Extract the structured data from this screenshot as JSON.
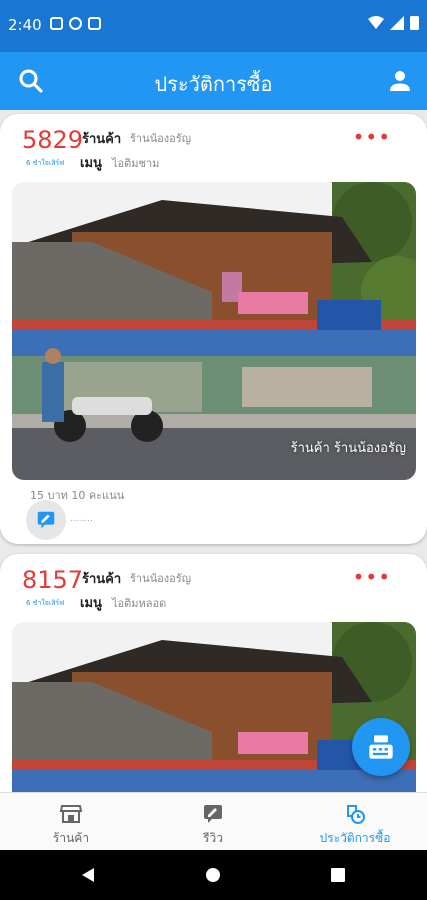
{
  "status_bar": {
    "time": "2:40"
  },
  "app_bar": {
    "title": "ประวัติการซื้อ",
    "search_icon": "search-icon",
    "account_icon": "account-icon"
  },
  "colors": {
    "primary": "#2196f3",
    "status": "#1976d2",
    "accent_red": "#e53935"
  },
  "cards": [
    {
      "number": "5829",
      "shop_label": "ร้านค้า",
      "shop_name": "ร้านน้องอรัญ",
      "sub_label": "6 ชำใจเสิร์ฟ",
      "menu_label": "เมนู",
      "menu_name": "ไอติมชาม",
      "photo_caption": "ร้านค้า ร้านน้องอรัญ",
      "price": "15 บาท 10 คะแนน",
      "review_dots": "........"
    },
    {
      "number": "8157",
      "shop_label": "ร้านค้า",
      "shop_name": "ร้านน้องอรัญ",
      "sub_label": "6 ชำใจเสิร์ฟ",
      "menu_label": "เมนู",
      "menu_name": "ไอติมหลอด"
    }
  ],
  "bottom_nav": [
    {
      "label": "ร้านค้า",
      "icon": "store-icon"
    },
    {
      "label": "รีวิว",
      "icon": "rate-review-icon"
    },
    {
      "label": "ประวัติการซื้อ",
      "icon": "history-icon",
      "active": true
    }
  ],
  "fab": {
    "icon": "cash-register-icon"
  }
}
